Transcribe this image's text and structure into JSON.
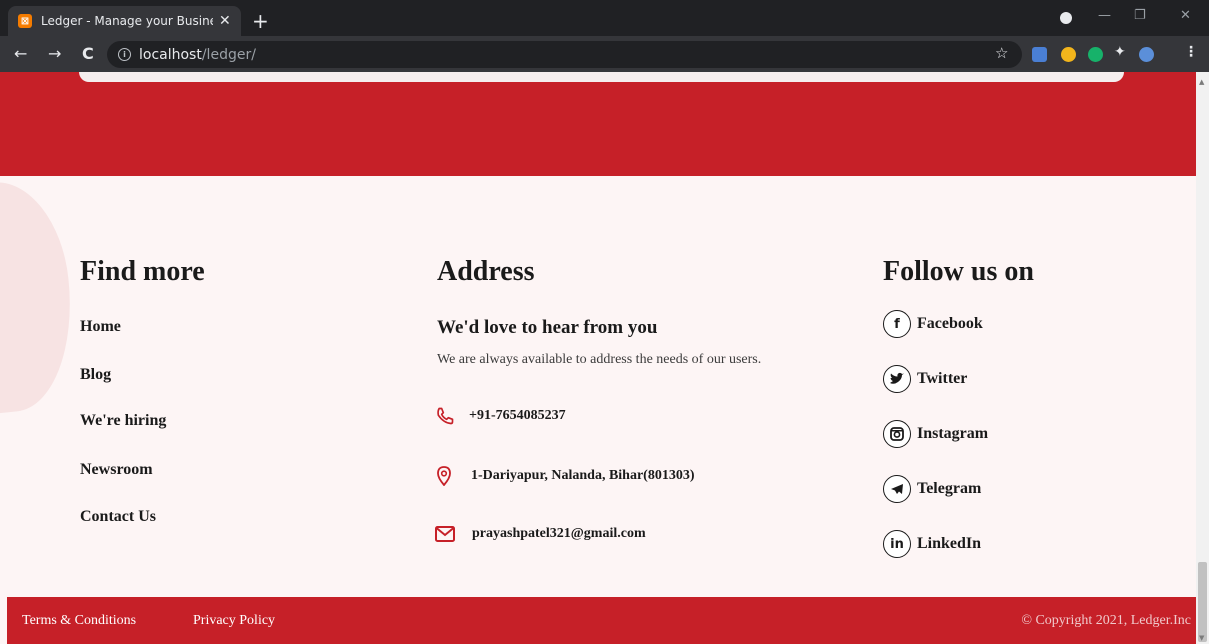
{
  "browser": {
    "tab_title": "Ledger - Manage your Business E",
    "tab_close": "✕",
    "new_tab": "+",
    "url_host": "localhost",
    "url_path": "/ledger/",
    "back": "←",
    "forward": "→",
    "reload": "C",
    "star": "☆"
  },
  "footer": {
    "find_more": {
      "title": "Find more",
      "links": [
        "Home",
        "Blog",
        "We're hiring",
        "Newsroom",
        "Contact Us"
      ]
    },
    "address": {
      "title": "Address",
      "subtitle": "We'd love to hear from you",
      "description": "We are always available to address the needs of our users.",
      "phone": "+91-7654085237",
      "location": "1-Dariyapur, Nalanda, Bihar(801303)",
      "email": "prayashpatel321@gmail.com"
    },
    "follow": {
      "title": "Follow us on",
      "links": [
        "Facebook",
        "Twitter",
        "Instagram",
        "Telegram",
        "LinkedIn"
      ]
    }
  },
  "bottom_bar": {
    "terms": "Terms & Conditions",
    "privacy": "Privacy Policy",
    "copyright": "© Copyright 2021, Ledger.Inc"
  },
  "colors": {
    "brand_red": "#c62028",
    "page_bg": "#fdf5f5"
  }
}
